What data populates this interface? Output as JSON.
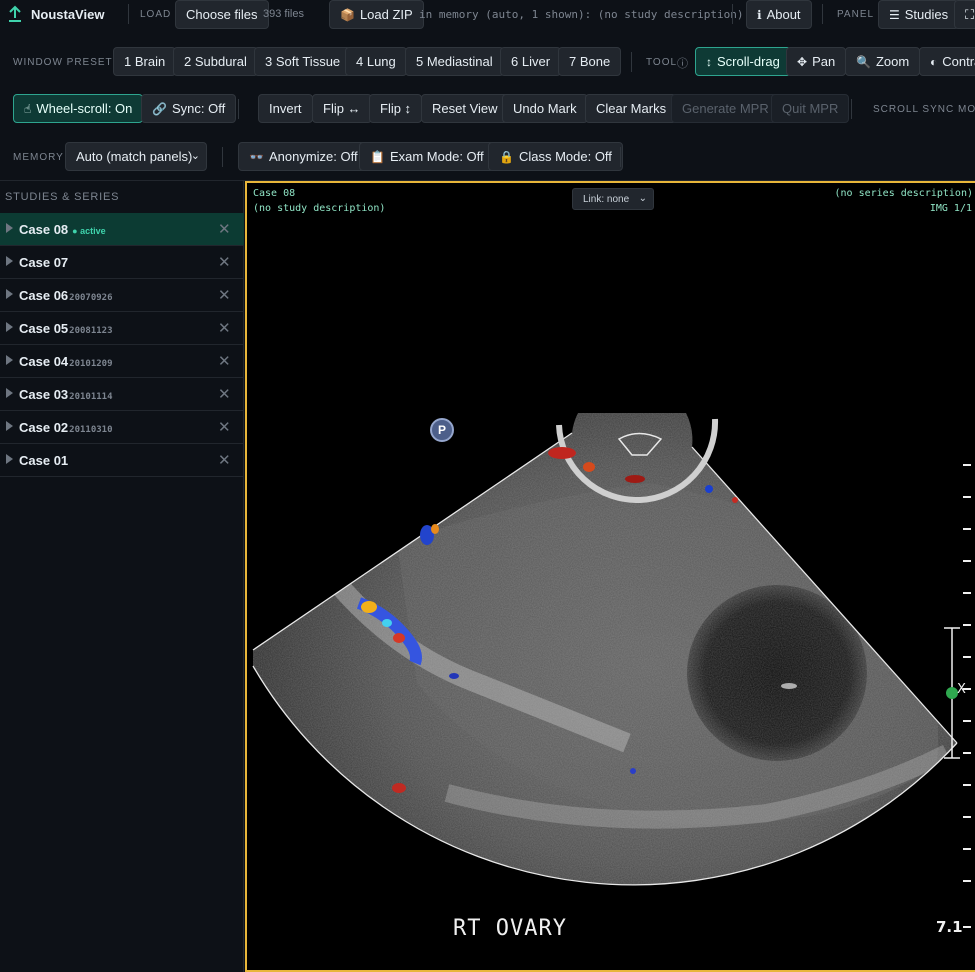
{
  "app": {
    "name": "NoustaView"
  },
  "load": {
    "label": "LOAD",
    "choose_files": "Choose files",
    "file_count": "393 files",
    "load_zip": "Load ZIP",
    "status": "in memory (auto, 1 shown): (no study description)"
  },
  "header": {
    "about": "About",
    "panel_label": "PANEL",
    "studies": "Studies",
    "fullscreen_icon": "expand-icon"
  },
  "window_presets": {
    "label": "WINDOW PRESETS",
    "items": [
      "1 Brain",
      "2 Subdural",
      "3 Soft Tissue",
      "4 Lung",
      "5 Mediastinal",
      "6 Liver",
      "7 Bone"
    ]
  },
  "tool": {
    "label": "TOOL",
    "items": [
      "Scroll-drag",
      "Pan",
      "Zoom",
      "Contrast"
    ]
  },
  "row3": {
    "wheel_scroll": "Wheel-scroll: On",
    "sync": "Sync: Off",
    "invert": "Invert",
    "flip_h": "Flip ↔",
    "flip_v": "Flip ↕",
    "reset_view": "Reset View",
    "undo_mark": "Undo Mark",
    "clear_marks": "Clear Marks",
    "generate_mpr": "Generate MPR",
    "quit_mpr": "Quit MPR",
    "scroll_sync_mode": "SCROLL SYNC MODE"
  },
  "row4": {
    "memory_label": "MEMORY",
    "memory_value": "Auto (match panels)",
    "anonymize": "Anonymize: Off",
    "exam_mode": "Exam Mode: Off",
    "class_mode": "Class Mode: Off"
  },
  "sidebar": {
    "title": "STUDIES & SERIES",
    "active_tag": "active",
    "items": [
      {
        "name": "Case 08",
        "date": ""
      },
      {
        "name": "Case 07",
        "date": ""
      },
      {
        "name": "Case 06",
        "date": "20070926"
      },
      {
        "name": "Case 05",
        "date": "20081123"
      },
      {
        "name": "Case 04",
        "date": "20101209"
      },
      {
        "name": "Case 03",
        "date": "20101114"
      },
      {
        "name": "Case 02",
        "date": "20110310"
      },
      {
        "name": "Case 01",
        "date": ""
      }
    ]
  },
  "viewport": {
    "case": "Case 08",
    "study_desc": "(no study description)",
    "series_desc": "(no series description)",
    "img_index": "IMG 1/1",
    "link": "Link: none",
    "caption": "RT OVARY",
    "depth": "7.1",
    "probe_badge": "P",
    "caliper_mark": "X"
  },
  "colors": {
    "accent": "#2ea58f",
    "frame": "#e8b63a",
    "overlay_text": "#8fe3c4"
  }
}
